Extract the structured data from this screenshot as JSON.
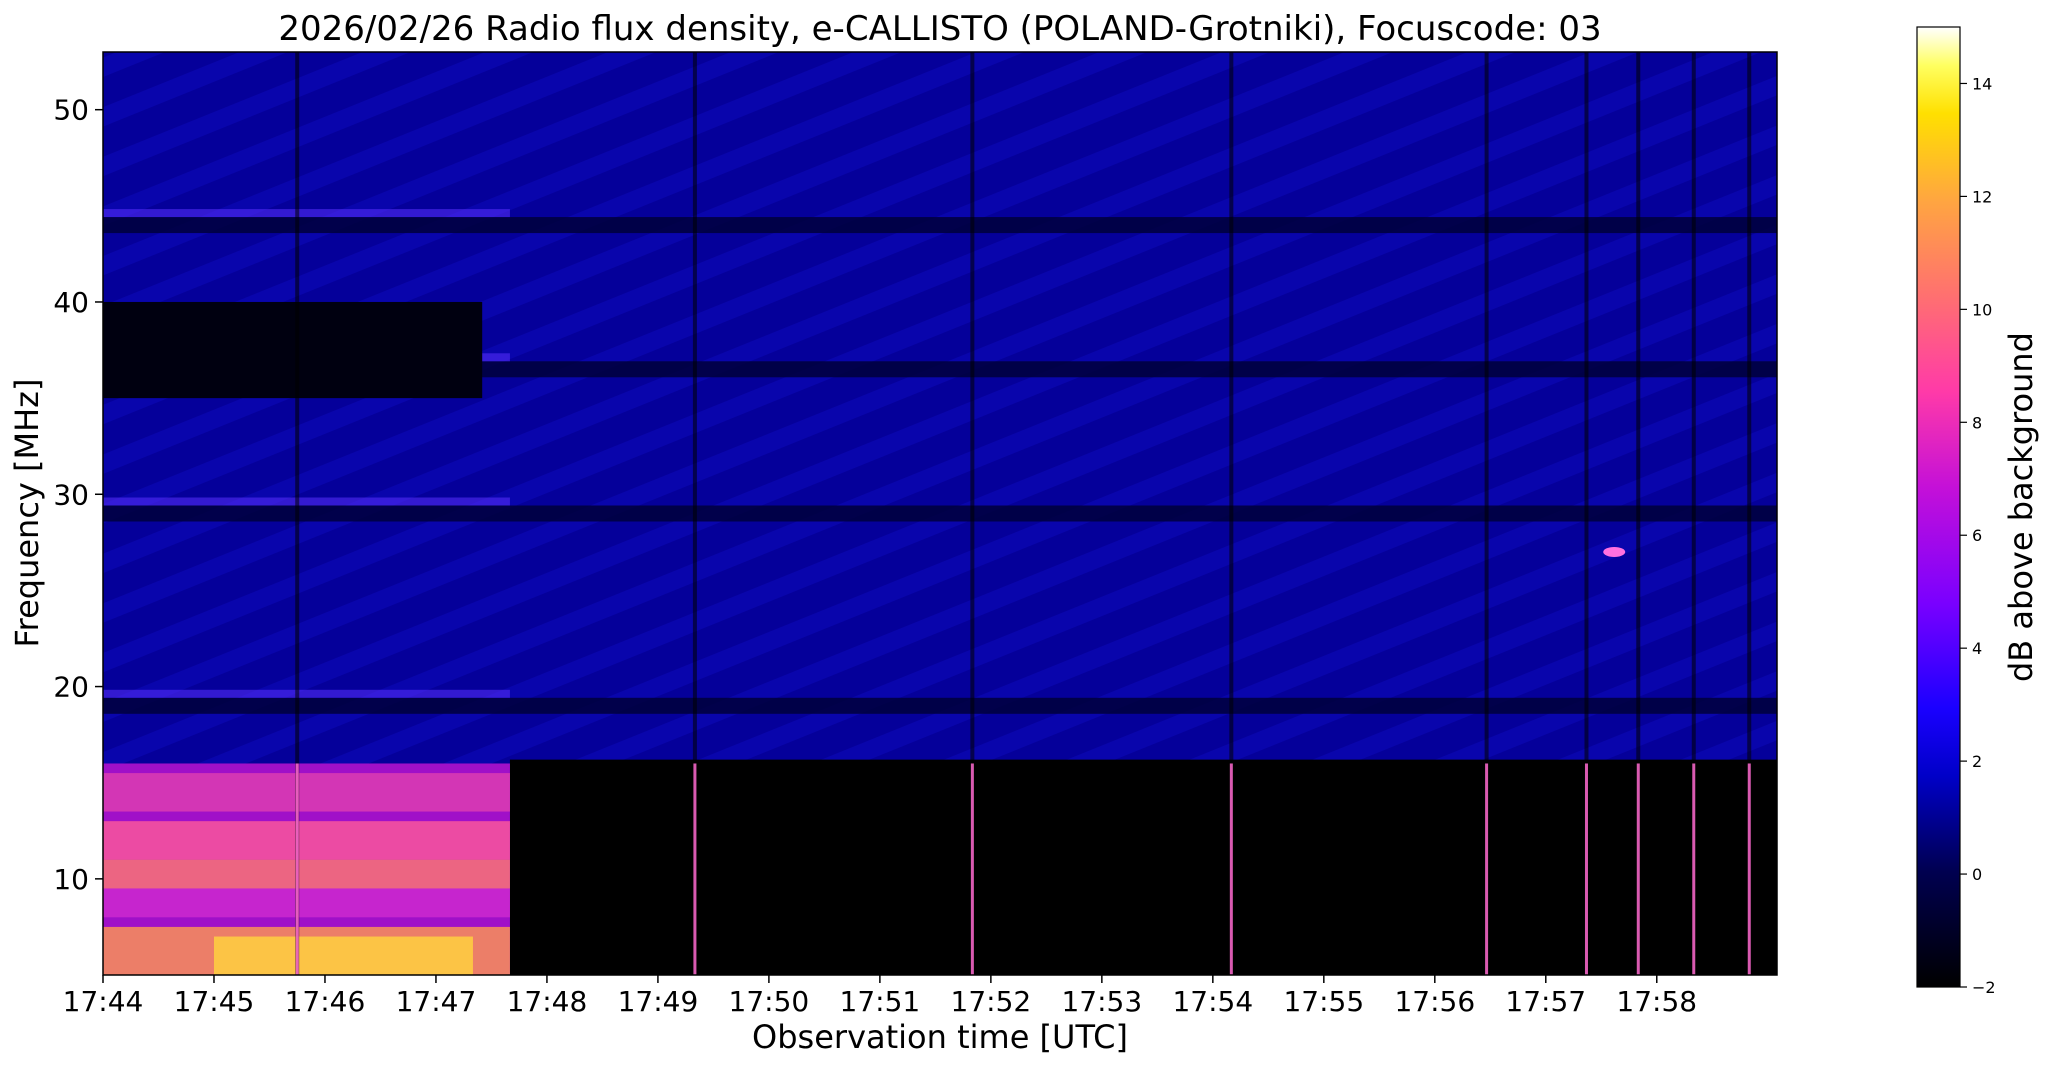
{
  "chart_data": {
    "type": "heatmap",
    "title": "2026/02/26  Radio flux density, e-CALLISTO (POLAND-Grotniki), Focuscode: 03",
    "xlabel": "Observation time [UTC]",
    "ylabel": "Frequency [MHz]",
    "colorbar_label": "dB above background",
    "colormap": "gnuplot2",
    "x_ticks": [
      "17:44",
      "17:45",
      "17:46",
      "17:47",
      "17:48",
      "17:49",
      "17:50",
      "17:51",
      "17:52",
      "17:53",
      "17:54",
      "17:55",
      "17:56",
      "17:57",
      "17:58"
    ],
    "xlim": [
      "17:44:00",
      "17:59:05"
    ],
    "y_ticks": [
      10,
      20,
      30,
      40,
      50
    ],
    "ylim": [
      5,
      53
    ],
    "colorbar_ticks": [
      -2,
      0,
      2,
      4,
      6,
      8,
      10,
      12,
      14
    ],
    "clim": [
      -2,
      15
    ],
    "features": {
      "interference_bands_mhz": [
        44,
        36.5,
        29,
        19
      ],
      "strong_low_freq_emission": {
        "time_start": "17:44:00",
        "time_end": "17:47:40",
        "freq_range_mhz": [
          5,
          16
        ]
      },
      "broadband_spikes_utc": [
        "17:45:45",
        "17:49:20",
        "17:51:50",
        "17:54:10",
        "17:56:28",
        "17:57:22",
        "17:57:50",
        "17:58:20",
        "17:58:50"
      ],
      "hotspot": {
        "time": "17:57:37",
        "freq_mhz": 27
      }
    }
  }
}
